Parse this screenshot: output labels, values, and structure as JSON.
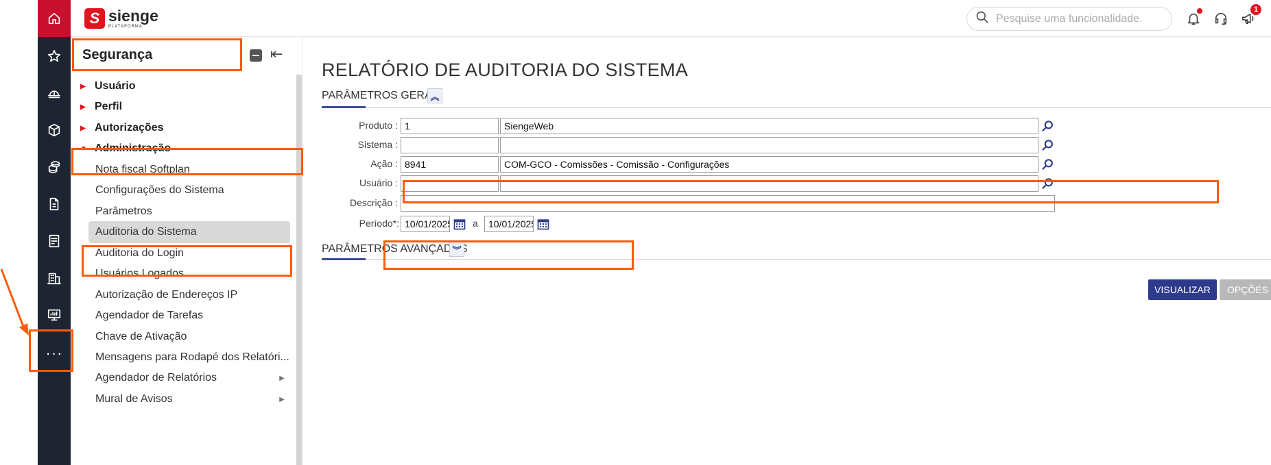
{
  "brand": {
    "name": "sienge",
    "subtitle": "PLATAFORMA",
    "mark": "S"
  },
  "header": {
    "search_placeholder": "Pesquise uma funcionalidade.",
    "notification_badge": "1"
  },
  "rail": {
    "items": [
      "home-icon",
      "star-icon",
      "helmet-icon",
      "box-icon",
      "coins-icon",
      "document-icon",
      "report-icon",
      "building-icon",
      "monitor-icon"
    ],
    "more_label": "···"
  },
  "sidebar": {
    "title": "Segurança",
    "groups": [
      {
        "label": "Usuário"
      },
      {
        "label": "Perfil"
      },
      {
        "label": "Autorizações"
      },
      {
        "label": "Administração"
      }
    ],
    "items": [
      {
        "label": "Nota fiscal Softplan"
      },
      {
        "label": "Configurações do Sistema"
      },
      {
        "label": "Parâmetros"
      },
      {
        "label": "Auditoria do Sistema"
      },
      {
        "label": "Auditoria do Login"
      },
      {
        "label": "Usuários Logados"
      },
      {
        "label": "Autorização de Endereços IP"
      },
      {
        "label": "Agendador de Tarefas"
      },
      {
        "label": "Chave de Ativação"
      },
      {
        "label": "Mensagens para Rodapé dos Relatóri..."
      },
      {
        "label": "Agendador de Relatórios"
      },
      {
        "label": "Mural de Avisos"
      }
    ]
  },
  "main": {
    "title": "RELATÓRIO DE AUDITORIA DO SISTEMA",
    "section_general": "PARÂMETROS GERAIS",
    "section_advanced": "PARÂMETROS AVANÇADOS",
    "fields": {
      "produto": {
        "label": "Produto :",
        "code": "1",
        "name": "SiengeWeb"
      },
      "sistema": {
        "label": "Sistema :",
        "code": "",
        "name": ""
      },
      "acao": {
        "label": "Ação :",
        "code": "8941",
        "name": "COM-GCO - Comissões - Comissão - Configurações"
      },
      "usuario": {
        "label": "Usuário :",
        "code": "",
        "name": ""
      },
      "descricao": {
        "label": "Descrição :",
        "value": ""
      },
      "periodo": {
        "label": "Período*:",
        "from": "10/01/2025",
        "separator": "a",
        "to": "10/01/2025"
      }
    },
    "buttons": {
      "view": "VISUALIZAR",
      "options": "OPÇÕES"
    }
  },
  "colors": {
    "brand_red": "#e0141e",
    "rail": "#1e2432",
    "primary": "#2e3a8c",
    "highlight": "#ff5a0a"
  }
}
